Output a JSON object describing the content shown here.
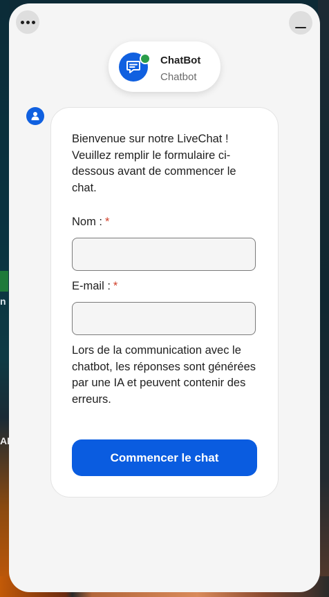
{
  "header": {
    "agent_name": "ChatBot",
    "agent_role": "Chatbot",
    "status_color": "#2a9d4a",
    "brand_color": "#1060e0"
  },
  "form": {
    "intro": "Bienvenue sur notre LiveChat ! Veuillez remplir le formulaire ci-dessous avant de commencer le chat.",
    "name_label": "Nom :",
    "email_label": "E-mail :",
    "required_marker": "*",
    "name_value": "",
    "email_value": "",
    "notice": "Lors de la communication avec le chatbot, les réponses sont générées par une IA et peuvent contenir des erreurs.",
    "start_button": "Commencer le chat"
  },
  "background": {
    "text1": "n",
    "text2": "AN"
  },
  "icons": {
    "menu": "more-horizontal-icon",
    "minimize": "minimize-icon",
    "agent": "chat-bubble-icon",
    "bot": "user-icon"
  }
}
